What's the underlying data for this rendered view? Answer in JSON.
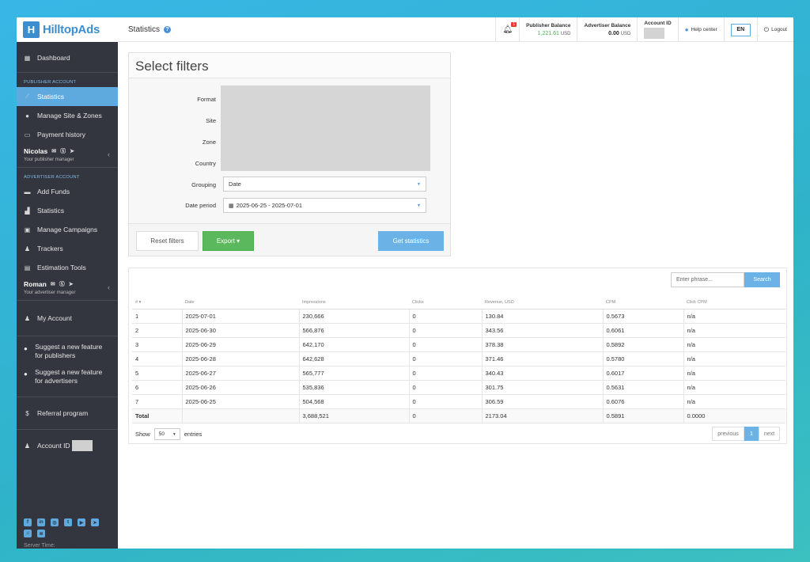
{
  "brand": {
    "logo_mark": "H",
    "name": "HilltopAds"
  },
  "page": {
    "title": "Statistics",
    "help_icon": "question-circle-icon"
  },
  "topbar": {
    "notification_count": "1",
    "publisher_balance": {
      "label": "Publisher Balance",
      "value": "1,221.61",
      "currency": "USD"
    },
    "advertiser_balance": {
      "label": "Advertiser Balance",
      "value": "0.00",
      "currency": "USD"
    },
    "account_id_label": "Account ID",
    "help_center": "Help center",
    "language": "EN",
    "logout": "Logout"
  },
  "sidebar": {
    "dashboard": "Dashboard",
    "publisher_section": "PUBLISHER ACCOUNT",
    "publisher_items": [
      "Statistics",
      "Manage Site & Zones",
      "Payment history"
    ],
    "publisher_manager": {
      "name": "Nicolas",
      "subtitle": "Your publisher manager"
    },
    "advertiser_section": "ADVERTISER ACCOUNT",
    "advertiser_items": [
      "Add Funds",
      "Statistics",
      "Manage Campaigns",
      "Trackers",
      "Estimation Tools"
    ],
    "advertiser_manager": {
      "name": "Roman",
      "subtitle": "Your advertiser manager"
    },
    "my_account": "My Account",
    "suggest_publishers": "Suggest a new feature for publishers",
    "suggest_advertisers": "Suggest a new feature for advertisers",
    "referral": "Referral program",
    "account_id": "Account ID",
    "server_time": "Server Time:"
  },
  "filters": {
    "title": "Select filters",
    "labels": {
      "format": "Format",
      "site": "Site",
      "zone": "Zone",
      "country": "Country",
      "grouping": "Grouping",
      "date_period": "Date period"
    },
    "grouping_value": "Date",
    "date_period_value": "2025-06-25 - 2025-07-01",
    "reset_label": "Reset filters",
    "export_label": "Export ▾",
    "get_label": "Get statistics"
  },
  "table": {
    "search_placeholder": "Enter phrase...",
    "search_label": "Search",
    "columns": [
      "# ▾",
      "Date",
      "Impressions",
      "Clicks",
      "Revenue, USD",
      "CPM",
      "Click CPM"
    ],
    "rows": [
      [
        "1",
        "2025-07-01",
        "230,666",
        "0",
        "130.84",
        "0.5673",
        "n/a"
      ],
      [
        "2",
        "2025-06-30",
        "566,876",
        "0",
        "343.56",
        "0.6061",
        "n/a"
      ],
      [
        "3",
        "2025-06-29",
        "642,170",
        "0",
        "378.38",
        "0.5892",
        "n/a"
      ],
      [
        "4",
        "2025-06-28",
        "642,628",
        "0",
        "371.46",
        "0.5780",
        "n/a"
      ],
      [
        "5",
        "2025-06-27",
        "565,777",
        "0",
        "340.43",
        "0.6017",
        "n/a"
      ],
      [
        "6",
        "2025-06-26",
        "535,836",
        "0",
        "301.75",
        "0.5631",
        "n/a"
      ],
      [
        "7",
        "2025-06-25",
        "504,568",
        "0",
        "306.59",
        "0.6076",
        "n/a"
      ]
    ],
    "total": [
      "Total",
      "",
      "3,688,521",
      "0",
      "2173.04",
      "0.5891",
      "0.0000"
    ],
    "show_label": "Show",
    "show_value": "50",
    "entries_label": "entries",
    "pager": {
      "previous": "previous",
      "page": "1",
      "next": "next"
    }
  },
  "colors": {
    "accent": "#5ea9de",
    "sidebar_bg": "#33363f",
    "export_green": "#5cb85c",
    "balance_green": "#4caf50"
  }
}
